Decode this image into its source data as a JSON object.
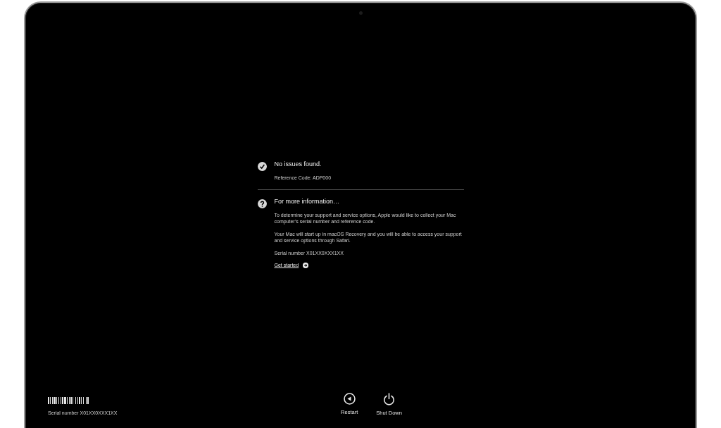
{
  "status": {
    "kind": "ok",
    "title": "No issues found.",
    "reference": "Reference Code: ADP000"
  },
  "info": {
    "kind": "help",
    "title": "For more information…",
    "paragraphs": [
      "To determine your support and service options, Apple would like to collect your Mac computer’s serial number and reference code.",
      "Your Mac will start up in macOS Recovery and you will be able to access your support and service options through Safari."
    ],
    "serial": "Serial number X01XX0XXX1XX",
    "link": "Get started"
  },
  "footer": {
    "serial": "Serial number X01XX0XXX1XX"
  },
  "buttons": [
    {
      "kind": "restart",
      "label": "Restart"
    },
    {
      "kind": "shutdown",
      "label": "Shut Down"
    }
  ]
}
